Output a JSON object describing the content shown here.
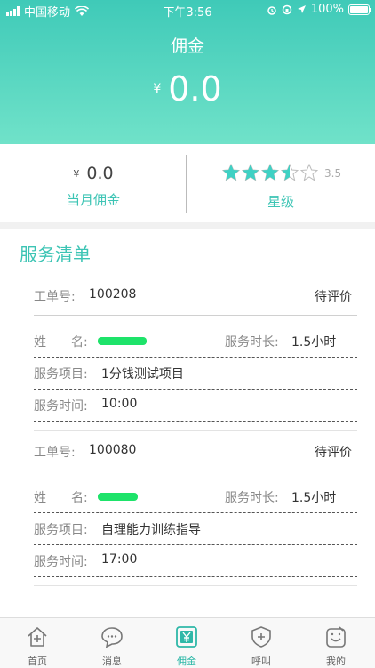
{
  "status_bar": {
    "carrier": "中国移动",
    "time": "下午3:56",
    "battery": "100%"
  },
  "header": {
    "title": "佣金",
    "currency": "¥",
    "amount": "0.0"
  },
  "stats": {
    "month": {
      "currency": "¥",
      "value": "0.0",
      "label": "当月佣金"
    },
    "rating": {
      "stars": 3.5,
      "value": "3.5",
      "label": "星级"
    }
  },
  "section_title": "服务清单",
  "orders": [
    {
      "order_label": "工单号:",
      "order_no": "100208",
      "status": "待评价",
      "name_label": "姓　　名:",
      "duration_label": "服务时长:",
      "duration": "1.5小时",
      "item_label": "服务项目:",
      "item": "1分钱测试项目",
      "time_label": "服务时间:",
      "time": "10:00"
    },
    {
      "order_label": "工单号:",
      "order_no": "100080",
      "status": "待评价",
      "name_label": "姓　　名:",
      "duration_label": "服务时长:",
      "duration": "1.5小时",
      "item_label": "服务项目:",
      "item": "自理能力训练指导",
      "time_label": "服务时间:",
      "time": "17:00"
    }
  ],
  "tabs": [
    {
      "label": "首页",
      "icon": "home-icon"
    },
    {
      "label": "消息",
      "icon": "chat-icon"
    },
    {
      "label": "佣金",
      "icon": "yen-icon",
      "active": true
    },
    {
      "label": "呼叫",
      "icon": "shield-plus-icon"
    },
    {
      "label": "我的",
      "icon": "profile-icon"
    }
  ],
  "colors": {
    "accent": "#3cc4b4",
    "header_top": "#3fcab8",
    "header_bottom": "#70e2c9",
    "star": "#3fd1c4"
  }
}
